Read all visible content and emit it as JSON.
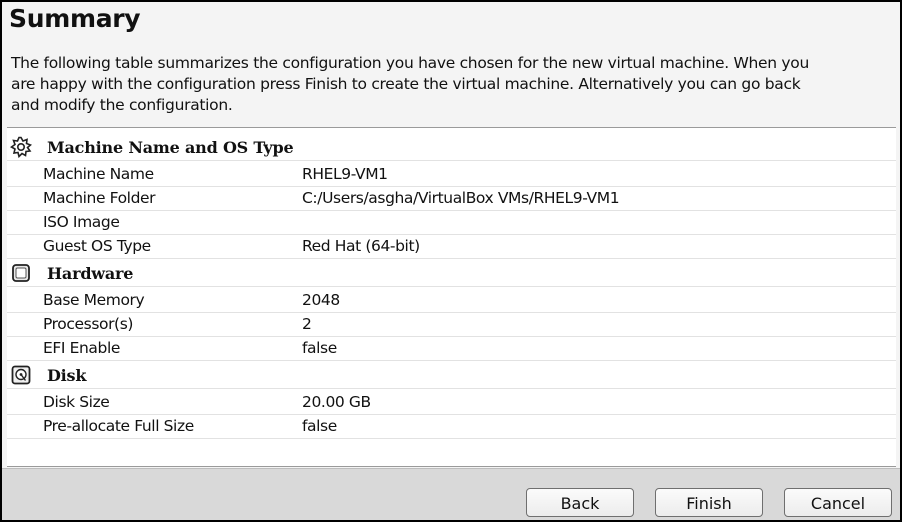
{
  "title": "Summary",
  "description": "The following table summarizes the configuration you have chosen for the new virtual machine. When you are happy with the configuration press Finish to create the virtual machine. Alternatively you can go back and modify the configuration.",
  "sections": [
    {
      "title": "Machine Name and OS Type",
      "icon": "os-type-gear-icon",
      "rows": [
        {
          "label": "Machine Name",
          "value": "RHEL9-VM1"
        },
        {
          "label": "Machine Folder",
          "value": "C:/Users/asgha/VirtualBox VMs/RHEL9-VM1"
        },
        {
          "label": "ISO Image",
          "value": ""
        },
        {
          "label": "Guest OS Type",
          "value": "Red Hat (64-bit)"
        }
      ]
    },
    {
      "title": "Hardware",
      "icon": "hardware-chip-icon",
      "rows": [
        {
          "label": "Base Memory",
          "value": "2048"
        },
        {
          "label": "Processor(s)",
          "value": "2"
        },
        {
          "label": "EFI Enable",
          "value": "false"
        }
      ]
    },
    {
      "title": "Disk",
      "icon": "hard-disk-icon",
      "rows": [
        {
          "label": "Disk Size",
          "value": "20.00 GB"
        },
        {
          "label": "Pre-allocate Full Size",
          "value": "false"
        }
      ]
    }
  ],
  "buttons": {
    "back": "Back",
    "finish": "Finish",
    "cancel": "Cancel"
  }
}
